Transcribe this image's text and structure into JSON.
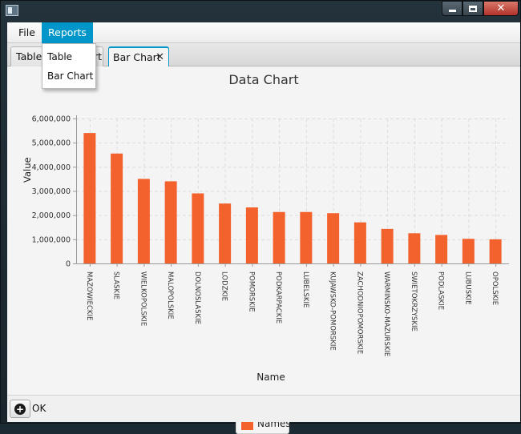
{
  "menu": {
    "file": "File",
    "reports": "Reports"
  },
  "reports_dropdown": {
    "items": [
      "Table",
      "Bar Chart"
    ]
  },
  "tabs": [
    {
      "label": "Table"
    },
    {
      "label": "Bar Chart",
      "close": "✕"
    }
  ],
  "tab_overlap_text": "rt",
  "window": {
    "close_glyph": "✕"
  },
  "footer": {
    "ok_label": "OK",
    "ok_icon": "+"
  },
  "chart_data": {
    "type": "bar",
    "title": "Data Chart",
    "xlabel": "Name",
    "ylabel": "Value",
    "ylim": [
      0,
      6000000
    ],
    "y_ticks": [
      0,
      1000000,
      2000000,
      3000000,
      4000000,
      5000000,
      6000000
    ],
    "y_tick_labels": [
      "0",
      "1,000,000",
      "2,000,000",
      "3,000,000",
      "4,000,000",
      "5,000,000",
      "6,000,000"
    ],
    "categories": [
      "MAZOWIECKIE",
      "SLASKIE",
      "WIELKOPOLSKIE",
      "MALOPOLSKIE",
      "DOLNOSLASKIE",
      "LODZKIE",
      "POMORSKIE",
      "PODKARPACKIE",
      "LUBELSKIE",
      "KUJAWSKO-POMORSKIE",
      "ZACHODNIOPOMORSKIE",
      "WARMINSKO-MAZURSKIE",
      "SWIETOKRZYSKIE",
      "PODLASKIE",
      "LUBUSKIE",
      "OPOLSKIE"
    ],
    "series": [
      {
        "name": "Names",
        "values": [
          5400000,
          4550000,
          3500000,
          3400000,
          2900000,
          2480000,
          2320000,
          2130000,
          2130000,
          2080000,
          1700000,
          1430000,
          1250000,
          1180000,
          1020000,
          1000000
        ]
      }
    ],
    "grid": true,
    "legend": "bottom-center",
    "bar_color": "#f3622d"
  }
}
